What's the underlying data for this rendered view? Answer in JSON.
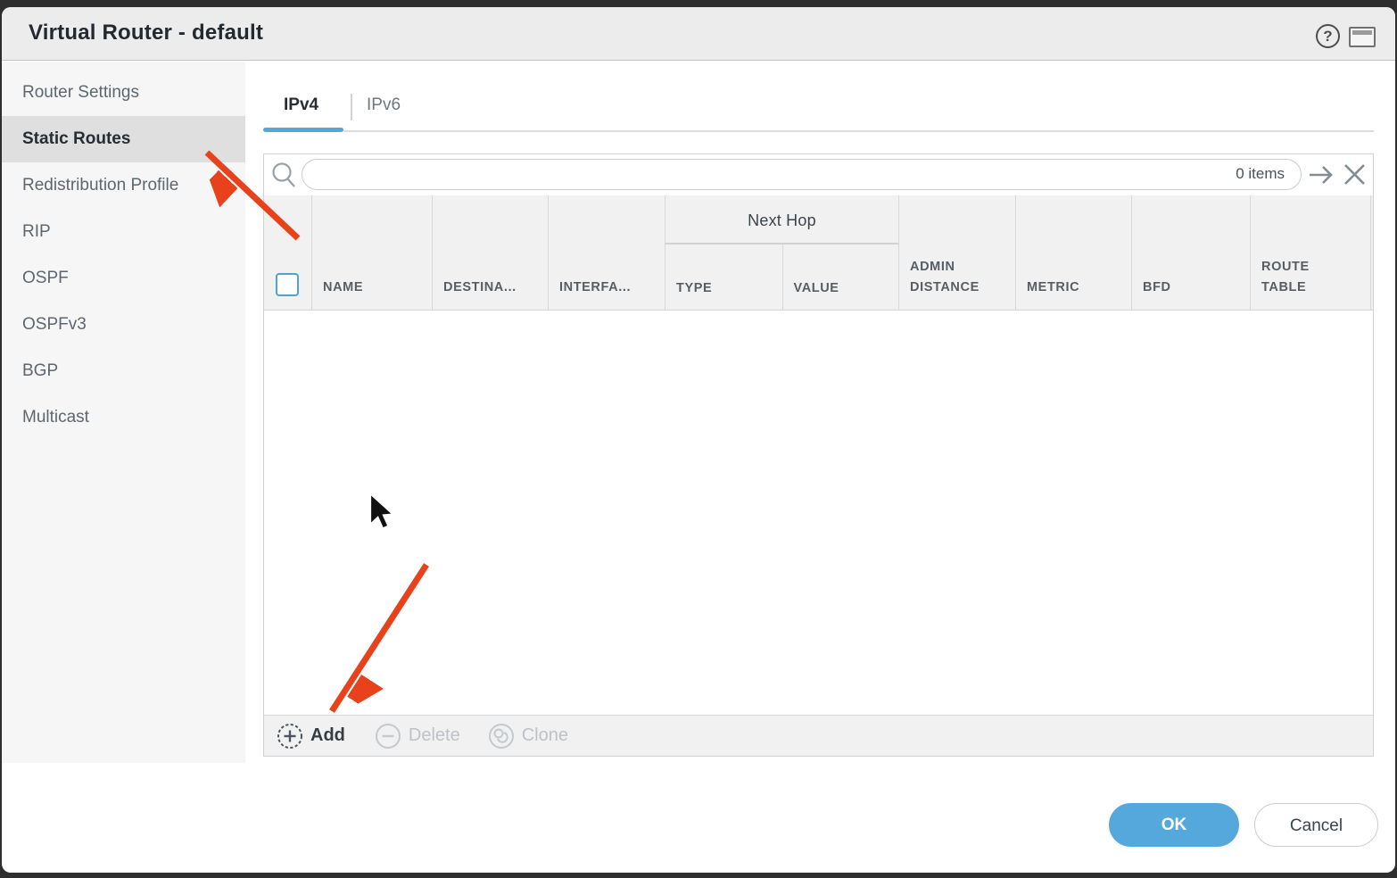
{
  "dialog": {
    "title": "Virtual Router - default"
  },
  "titlebar_icons": {
    "help": "?",
    "window": "window-restore"
  },
  "sidebar": {
    "items": [
      {
        "label": "Router Settings",
        "selected": false
      },
      {
        "label": "Static Routes",
        "selected": true
      },
      {
        "label": "Redistribution Profile",
        "selected": false
      },
      {
        "label": "RIP",
        "selected": false
      },
      {
        "label": "OSPF",
        "selected": false
      },
      {
        "label": "OSPFv3",
        "selected": false
      },
      {
        "label": "BGP",
        "selected": false
      },
      {
        "label": "Multicast",
        "selected": false
      }
    ]
  },
  "tabs": [
    {
      "label": "IPv4",
      "active": true
    },
    {
      "label": "IPv6",
      "active": false
    }
  ],
  "search": {
    "placeholder": "",
    "value": "",
    "count_label": "0 items",
    "icons": {
      "magnifier": "search-icon",
      "apply": "arrow-right-icon",
      "clear": "x-icon"
    }
  },
  "table": {
    "group_header": "Next Hop",
    "columns": [
      "NAME",
      "DESTINA...",
      "INTERFA...",
      "TYPE",
      "VALUE",
      "ADMIN DISTANCE",
      "METRIC",
      "BFD",
      "ROUTE TABLE"
    ],
    "rows": []
  },
  "toolbar": {
    "add_label": "Add",
    "delete_label": "Delete",
    "clone_label": "Clone",
    "add_enabled": true,
    "delete_enabled": false,
    "clone_enabled": false
  },
  "footer": {
    "ok_label": "OK",
    "cancel_label": "Cancel"
  },
  "annotations": {
    "arrow_1_points_to": "Static Routes",
    "arrow_2_points_to": "Add"
  },
  "colors": {
    "accent_blue": "#54a7d7",
    "ok_button_blue": "#54a8dc",
    "arrow_red": "#e8421c",
    "titlebar_gray": "#ececec",
    "sidebar_selected_gray": "#dfdfdf",
    "header_bg": "#f1f1f2",
    "disabled_gray": "#bcc2c8"
  }
}
